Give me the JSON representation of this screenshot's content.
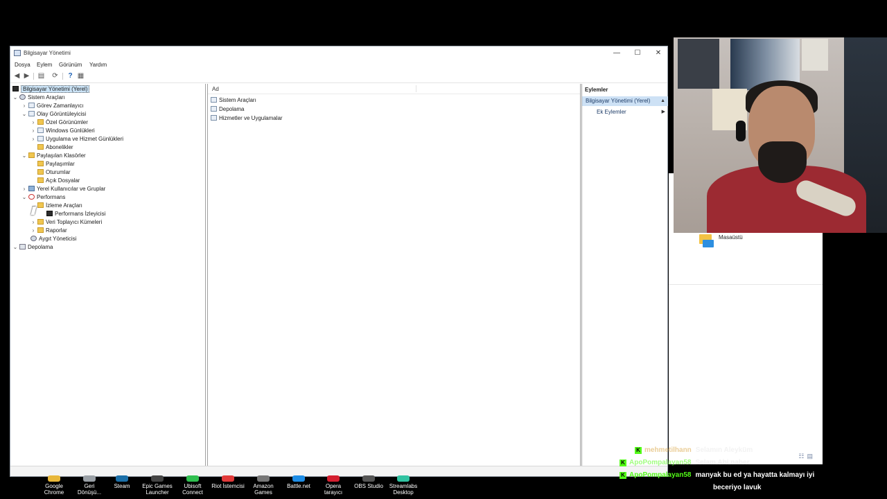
{
  "window": {
    "title": "Bilgisayar Yönetimi",
    "controls": {
      "minimize": "—",
      "maximize": "☐",
      "close": "✕"
    }
  },
  "menu": [
    "Dosya",
    "Eylem",
    "Görünüm",
    "Yardım"
  ],
  "tree": {
    "root": "Bilgisayar Yönetimi (Yerel)",
    "items": [
      {
        "label": "Sistem Araçları"
      },
      {
        "label": "Görev Zamanlayıcı"
      },
      {
        "label": "Olay Görüntüleyicisi"
      },
      {
        "label": "Özel Görünümler"
      },
      {
        "label": "Windows Günlükleri"
      },
      {
        "label": "Uygulama ve Hizmet Günlükleri"
      },
      {
        "label": "Abonelikler"
      },
      {
        "label": "Paylaşılan Klasörler"
      },
      {
        "label": "Paylaşımlar"
      },
      {
        "label": "Oturumlar"
      },
      {
        "label": "Açık Dosyalar"
      },
      {
        "label": "Yerel Kullanıcılar ve Gruplar"
      },
      {
        "label": "Performans"
      },
      {
        "label": "İzleme Araçları"
      },
      {
        "label": "Performans İzleyicisi"
      },
      {
        "label": "Veri Toplayıcı Kümeleri"
      },
      {
        "label": "Raporlar"
      },
      {
        "label": "Aygıt Yöneticisi"
      },
      {
        "label": "Depolama"
      }
    ]
  },
  "middle": {
    "column_header": "Ad",
    "items": [
      "Sistem Araçları",
      "Depolama",
      "Hizmetler ve Uygulamalar"
    ]
  },
  "actions": {
    "header": "Eylemler",
    "selected": "Bilgisayar Yönetimi (Yerel)",
    "items": [
      "Ek Eylemler"
    ]
  },
  "desktop": {
    "folder_label": "Masaüstü"
  },
  "taskbar": [
    {
      "l1": "Google",
      "l2": "Chrome",
      "color": "#e8b73a"
    },
    {
      "l1": "Geri",
      "l2": "Dönüşü...",
      "color": "#9aa0a6"
    },
    {
      "l1": "Steam",
      "l2": "",
      "color": "#1b6fa8"
    },
    {
      "l1": "Epic Games",
      "l2": "Launcher",
      "color": "#444"
    },
    {
      "l1": "Ubisoft",
      "l2": "Connect",
      "color": "#2fbf4f"
    },
    {
      "l1": "Riot İstemcisi",
      "l2": "",
      "color": "#e23a3a"
    },
    {
      "l1": "Amazon",
      "l2": "Games",
      "color": "#777"
    },
    {
      "l1": "Battle.net",
      "l2": "",
      "color": "#1e8de6"
    },
    {
      "l1": "Opera",
      "l2": "tarayıcı",
      "color": "#d41f2f"
    },
    {
      "l1": "OBS Studio",
      "l2": "",
      "color": "#555"
    },
    {
      "l1": "Streamlabs",
      "l2": "Desktop",
      "color": "#31c3a2"
    }
  ],
  "chat": [
    {
      "user": "mehmetilhann",
      "msg": "Selamın Aleyküm",
      "user_color": "#d9a441"
    },
    {
      "user": "ApoPompalayan58",
      "msg": "Selam Abi naber",
      "user_color": "#53fc18"
    },
    {
      "user": "ApoPompalayan58",
      "msg": "manyak bu ed ya hayatta kalmayı iyi",
      "msg2": "beceriyo lavuk",
      "user_color": "#53fc18"
    }
  ]
}
